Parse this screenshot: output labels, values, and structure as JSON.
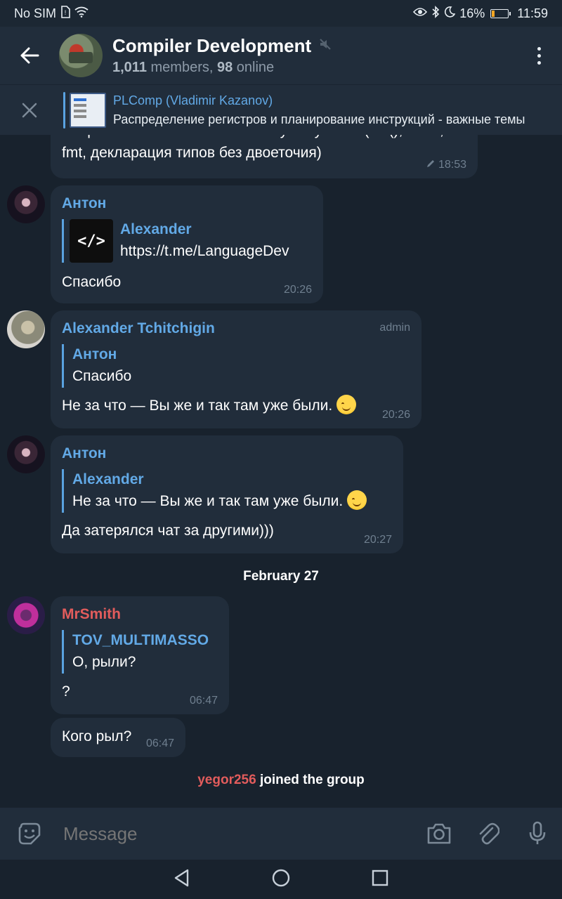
{
  "status_bar": {
    "carrier": "No SIM",
    "battery": "16%",
    "battery_level": 0.16,
    "time": "11:59"
  },
  "header": {
    "title": "Compiler Development",
    "members": "1,011",
    "members_suffix": " members, ",
    "online": "98",
    "online_suffix": " online"
  },
  "pinned": {
    "title": "PLComp (Vladimir Kazanov)",
    "text": "Распределение регистров и планирование инструкций - важные темы"
  },
  "messages": {
    "m0": {
      "line1": "Скорее на смесь Rust и C++ и чуть-чуть Go (len(), defer,",
      "line2": "fmt, декларация типов без двоеточия)",
      "time": "18:53"
    },
    "m1": {
      "sender": "Антон",
      "reply_name": "Alexander",
      "reply_text": "https://t.me/LanguageDev",
      "reply_thumb": "</>",
      "text": "Спасибо",
      "time": "20:26"
    },
    "m2": {
      "sender": "Alexander Tchitchigin",
      "badge": "admin",
      "reply_name": "Антон",
      "reply_text": "Спасибо",
      "text": "Не за что — Вы же и так там уже были.",
      "time": "20:26"
    },
    "m3": {
      "sender": "Антон",
      "reply_name": "Alexander",
      "reply_text": "Не за что — Вы же и так там уже были.",
      "text": "Да затерялся чат за другими)))",
      "time": "20:27"
    },
    "date_separator": "February 27",
    "m4": {
      "sender": "MrSmith",
      "reply_name": "TOV_MULTIMASSO",
      "reply_text": "О, рыли?",
      "text": "?",
      "time": "06:47"
    },
    "m5": {
      "text": "Кого рыл?",
      "time": "06:47"
    },
    "service": {
      "username": "yegor256",
      "action": " joined the group"
    }
  },
  "input": {
    "placeholder": "Message"
  },
  "colors": {
    "accent": "#62a9e6",
    "bubble": "#212d3b",
    "background": "#18222d",
    "sender_anton": "#62a9e6",
    "sender_mrsmith": "#e25c5c"
  },
  "icons": [
    "no-sim-icon",
    "wifi-icon",
    "eye-icon",
    "bluetooth-icon",
    "moon-icon",
    "back-arrow-icon",
    "muted-icon",
    "menu-icon",
    "close-icon",
    "edit-icon",
    "sticker-icon",
    "camera-icon",
    "attach-icon",
    "mic-icon",
    "nav-back-icon",
    "nav-home-icon",
    "nav-recent-icon"
  ]
}
